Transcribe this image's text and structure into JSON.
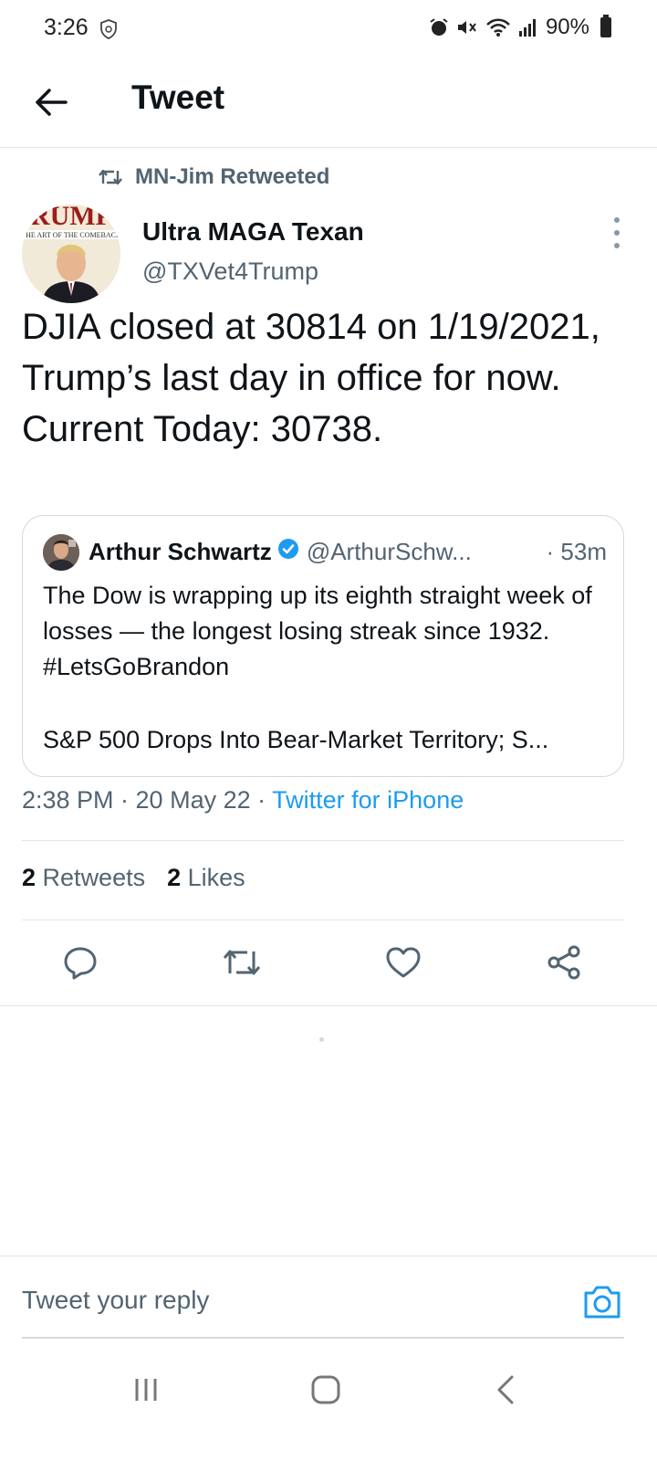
{
  "status_bar": {
    "time": "3:26",
    "battery": "90%"
  },
  "header": {
    "title": "Tweet"
  },
  "retweet_context": {
    "label": "MN-Jim Retweeted"
  },
  "tweet": {
    "author_name": "Ultra MAGA Texan",
    "author_handle": "@TXVet4Trump",
    "avatar_text": "THE ART OF THE COMEBACK",
    "text": "DJIA closed at 30814 on 1/19/2021, Trump’s last day in office for now. Current Today: 30738.",
    "timestamp": "2:38 PM · 20 May 22 · ",
    "source": "Twitter for iPhone"
  },
  "quoted_tweet": {
    "author_name": "Arthur Schwartz",
    "author_handle": "@ArthurSchw...",
    "time": "· 53m",
    "text": "The Dow is wrapping up its eighth straight week of losses — the longest losing streak since 1932. #LetsGoBrandon",
    "link_preview": "S&P 500 Drops Into Bear-Market Territory; S..."
  },
  "stats": {
    "retweets_count": "2",
    "retweets_label": "Retweets",
    "likes_count": "2",
    "likes_label": "Likes"
  },
  "reply": {
    "placeholder": "Tweet your reply"
  },
  "colors": {
    "accent": "#1d9bf0",
    "text_primary": "#0f1419",
    "text_secondary": "#536471",
    "border": "#e1e6ea"
  },
  "icons": {
    "status": [
      "shield-icon",
      "alarm-icon",
      "mute-icon",
      "wifi-icon",
      "signal-icon",
      "battery-icon"
    ],
    "actions": [
      "reply-icon",
      "retweet-icon",
      "like-icon",
      "share-icon"
    ],
    "nav": [
      "recents-icon",
      "home-icon",
      "back-icon"
    ]
  }
}
